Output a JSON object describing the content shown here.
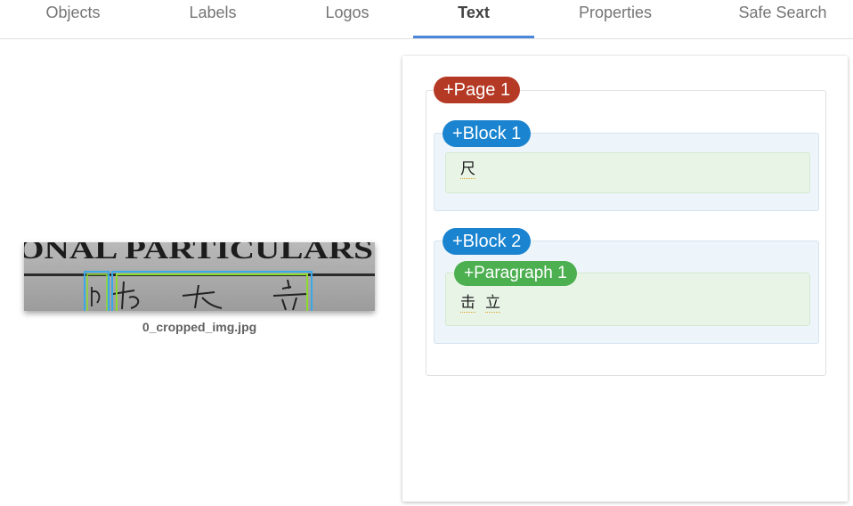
{
  "tabs": [
    {
      "label": "Objects",
      "active": false
    },
    {
      "label": "Labels",
      "active": false
    },
    {
      "label": "Logos",
      "active": false
    },
    {
      "label": "Text",
      "active": true
    },
    {
      "label": "Properties",
      "active": false
    },
    {
      "label": "Safe Search",
      "active": false
    }
  ],
  "image": {
    "filename": "0_cropped_img.jpg",
    "header_text": "ONAL PARTICULARS"
  },
  "colors": {
    "page_chip": "#b53a25",
    "block_chip": "#1a84d0",
    "paragraph_chip": "#4caf50",
    "active_tab_indicator": "#4a86d9"
  },
  "text_tree": {
    "page": {
      "label": "+Page 1",
      "blocks": [
        {
          "label": "+Block 1",
          "paragraphs": [
            {
              "label": "",
              "words": [
                "尺"
              ]
            }
          ]
        },
        {
          "label": "+Block 2",
          "paragraphs": [
            {
              "label": "+Paragraph 1",
              "words": [
                "击",
                "立"
              ]
            }
          ]
        }
      ]
    }
  }
}
